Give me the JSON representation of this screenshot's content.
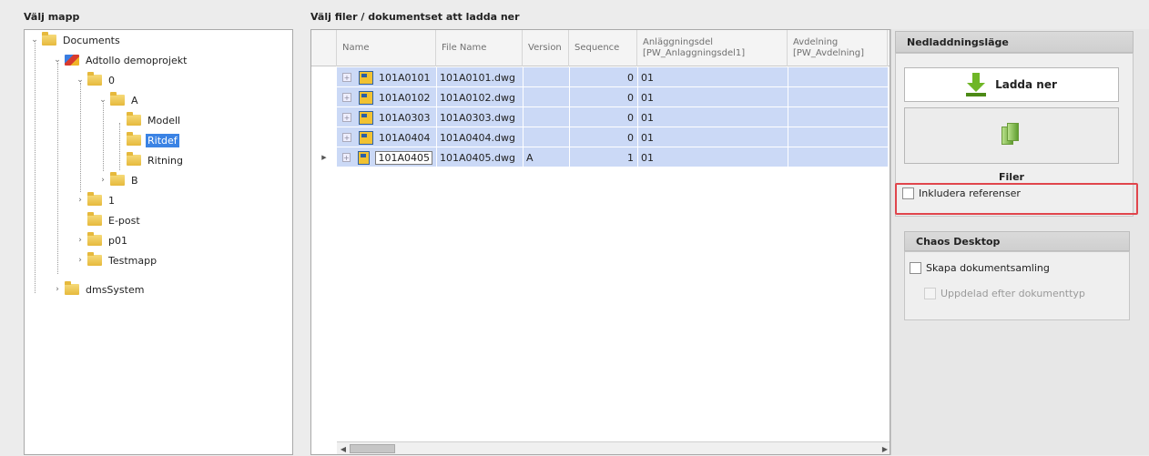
{
  "left_panel": {
    "title": "Välj mapp",
    "tree": [
      {
        "label": "Documents"
      },
      {
        "label": "Adtollo demoprojekt"
      },
      {
        "label": "0"
      },
      {
        "label": "A"
      },
      {
        "label": "Modell"
      },
      {
        "label": "Ritdef"
      },
      {
        "label": "Ritning"
      },
      {
        "label": "B"
      },
      {
        "label": "1"
      },
      {
        "label": "E-post"
      },
      {
        "label": "p01"
      },
      {
        "label": "Testmapp"
      },
      {
        "label": "dmsSystem"
      }
    ]
  },
  "grid": {
    "title": "Välj filer / dokumentset att ladda ner",
    "columns": {
      "name": "Name",
      "file_name": "File Name",
      "version": "Version",
      "sequence": "Sequence",
      "anlaggningsdel_1": "Anläggningsdel",
      "anlaggningsdel_2": "[PW_Anlaggningsdel1]",
      "avdelning_1": "Avdelning",
      "avdelning_2": "[PW_Avdelning]"
    },
    "rows": [
      {
        "name": "101A0101",
        "file_name": "101A0101.dwg",
        "version": "",
        "sequence": "0",
        "anlaggningsdel": "01",
        "avdelning": ""
      },
      {
        "name": "101A0102",
        "file_name": "101A0102.dwg",
        "version": "",
        "sequence": "0",
        "anlaggningsdel": "01",
        "avdelning": ""
      },
      {
        "name": "101A0303",
        "file_name": "101A0303.dwg",
        "version": "",
        "sequence": "0",
        "anlaggningsdel": "01",
        "avdelning": ""
      },
      {
        "name": "101A0404",
        "file_name": "101A0404.dwg",
        "version": "",
        "sequence": "0",
        "anlaggningsdel": "01",
        "avdelning": ""
      },
      {
        "name": "101A0405",
        "file_name": "101A0405.dwg",
        "version": "A",
        "sequence": "1",
        "anlaggningsdel": "01",
        "avdelning": ""
      }
    ]
  },
  "right_panel": {
    "download_group": {
      "title": "Nedladdningsläge",
      "download_button": "Ladda ner",
      "files_label": "Filer",
      "include_references": "Inkludera referenser"
    },
    "chaos_group": {
      "title": "Chaos Desktop",
      "create_collection": "Skapa dokumentsamling",
      "split_by_type": "Uppdelad efter dokumenttyp"
    }
  },
  "icons": {
    "folder": "folder-icon",
    "project": "project-icon",
    "file": "dwg-file-icon",
    "download": "download-arrow-icon",
    "files": "files-icon"
  },
  "colors": {
    "selection": "#3b83e4",
    "row_highlight": "#cbd9f6",
    "annotation_box": "#e0454c",
    "download_arrow": "#6fb626"
  }
}
